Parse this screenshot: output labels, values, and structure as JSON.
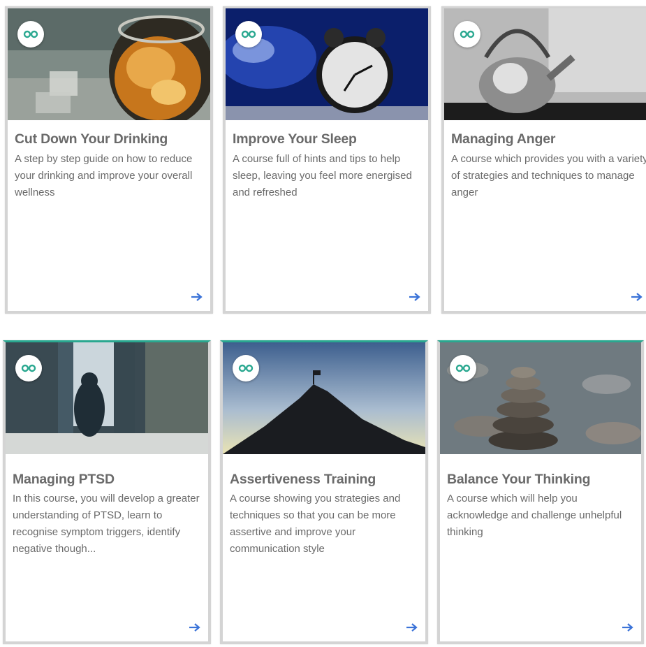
{
  "courses": [
    {
      "title": "Cut Down Your Drinking",
      "description": "A step by step guide on how to reduce your drinking and improve your overall wellness",
      "image": "whisky-glass-image"
    },
    {
      "title": "Improve Your Sleep",
      "description": "A course full of hints and tips to help sleep, leaving you feel more energised and refreshed",
      "image": "alarm-clock-image"
    },
    {
      "title": "Managing Anger",
      "description": "A course which provides you with a variety of strategies and techniques to manage anger",
      "image": "boiling-kettle-image"
    },
    {
      "title": "Managing PTSD",
      "description": "In this course, you will develop a greater understanding of PTSD, learn to recognise symptom triggers, identify negative though...",
      "image": "woman-by-window-image"
    },
    {
      "title": "Assertiveness Training",
      "description": "A course showing you strategies and techniques so that you can be more assertive and improve your communication style",
      "image": "mountain-summit-image"
    },
    {
      "title": "Balance Your Thinking",
      "description": "A course which will help you acknowledge and challenge unhelpful thinking",
      "image": "stacked-stones-image"
    }
  ],
  "icons": {
    "badge": "glasses-icon",
    "open": "arrow-right-icon"
  },
  "colors": {
    "accent": "#2aa890",
    "arrow": "#3b73d8",
    "text": "#6a6a6a"
  }
}
